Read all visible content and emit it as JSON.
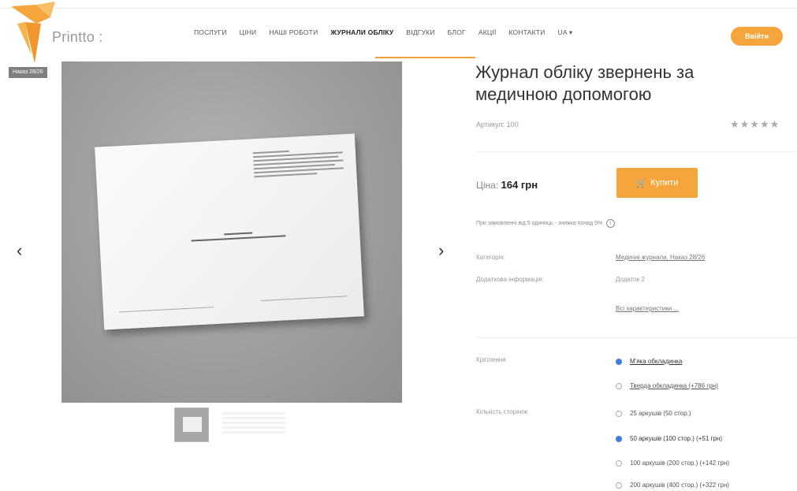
{
  "header": {
    "logo_text": "Printto :",
    "nav": [
      {
        "label": "ПОСЛУГИ",
        "active": false
      },
      {
        "label": "ЦІНИ",
        "active": false
      },
      {
        "label": "НАШІ РОБОТИ",
        "active": false
      },
      {
        "label": "ЖУРНАЛИ ОБЛІКУ",
        "active": true
      },
      {
        "label": "ВІДГУКИ",
        "active": false
      },
      {
        "label": "БЛОГ",
        "active": false
      },
      {
        "label": "АКЦІЇ",
        "active": false
      },
      {
        "label": "КОНТАКТИ",
        "active": false
      },
      {
        "label": "UA ▾",
        "active": false
      }
    ],
    "login_label": "Ввійти",
    "accent_color": "#f5a53b"
  },
  "gallery": {
    "badge": "Наказ 28/26",
    "prev_icon": "chevron-left-icon",
    "next_icon": "chevron-right-icon"
  },
  "product": {
    "title": "Журнал обліку звернень за медичною допомогою",
    "article": "Артикул: 100",
    "rating": "★★★★★",
    "price_label": "Ціна:",
    "price_value": "164 грн",
    "buy_label": "Купити",
    "bulk_note": "При замовленні від 5 одиниць - знижка понад 5%",
    "category_label": "Категорія:",
    "category_value": "Медичні журнали, Наказ 28/26",
    "extra_label": "Додаткова інформація:",
    "extra_value": "Додаток 2",
    "all_specs": "Всі характеристики ..."
  },
  "binding": {
    "label": "Кріплення",
    "options": [
      {
        "label": "М'яка обкладинка",
        "selected": true
      },
      {
        "label": "Тверда обкладинка (+786 грн)",
        "selected": false
      }
    ]
  },
  "pages": {
    "label": "Кількість сторінок",
    "options": [
      {
        "label": "25 аркушів (50 стор.)",
        "selected": false
      },
      {
        "label": "50 аркушів (100 стор.) (+51 грн)",
        "selected": true
      },
      {
        "label": "100 аркушів (200 стор.) (+142 грн)",
        "selected": false
      },
      {
        "label": "200 аркушів (400 стор.) (+322 грн)",
        "selected": false
      }
    ]
  }
}
